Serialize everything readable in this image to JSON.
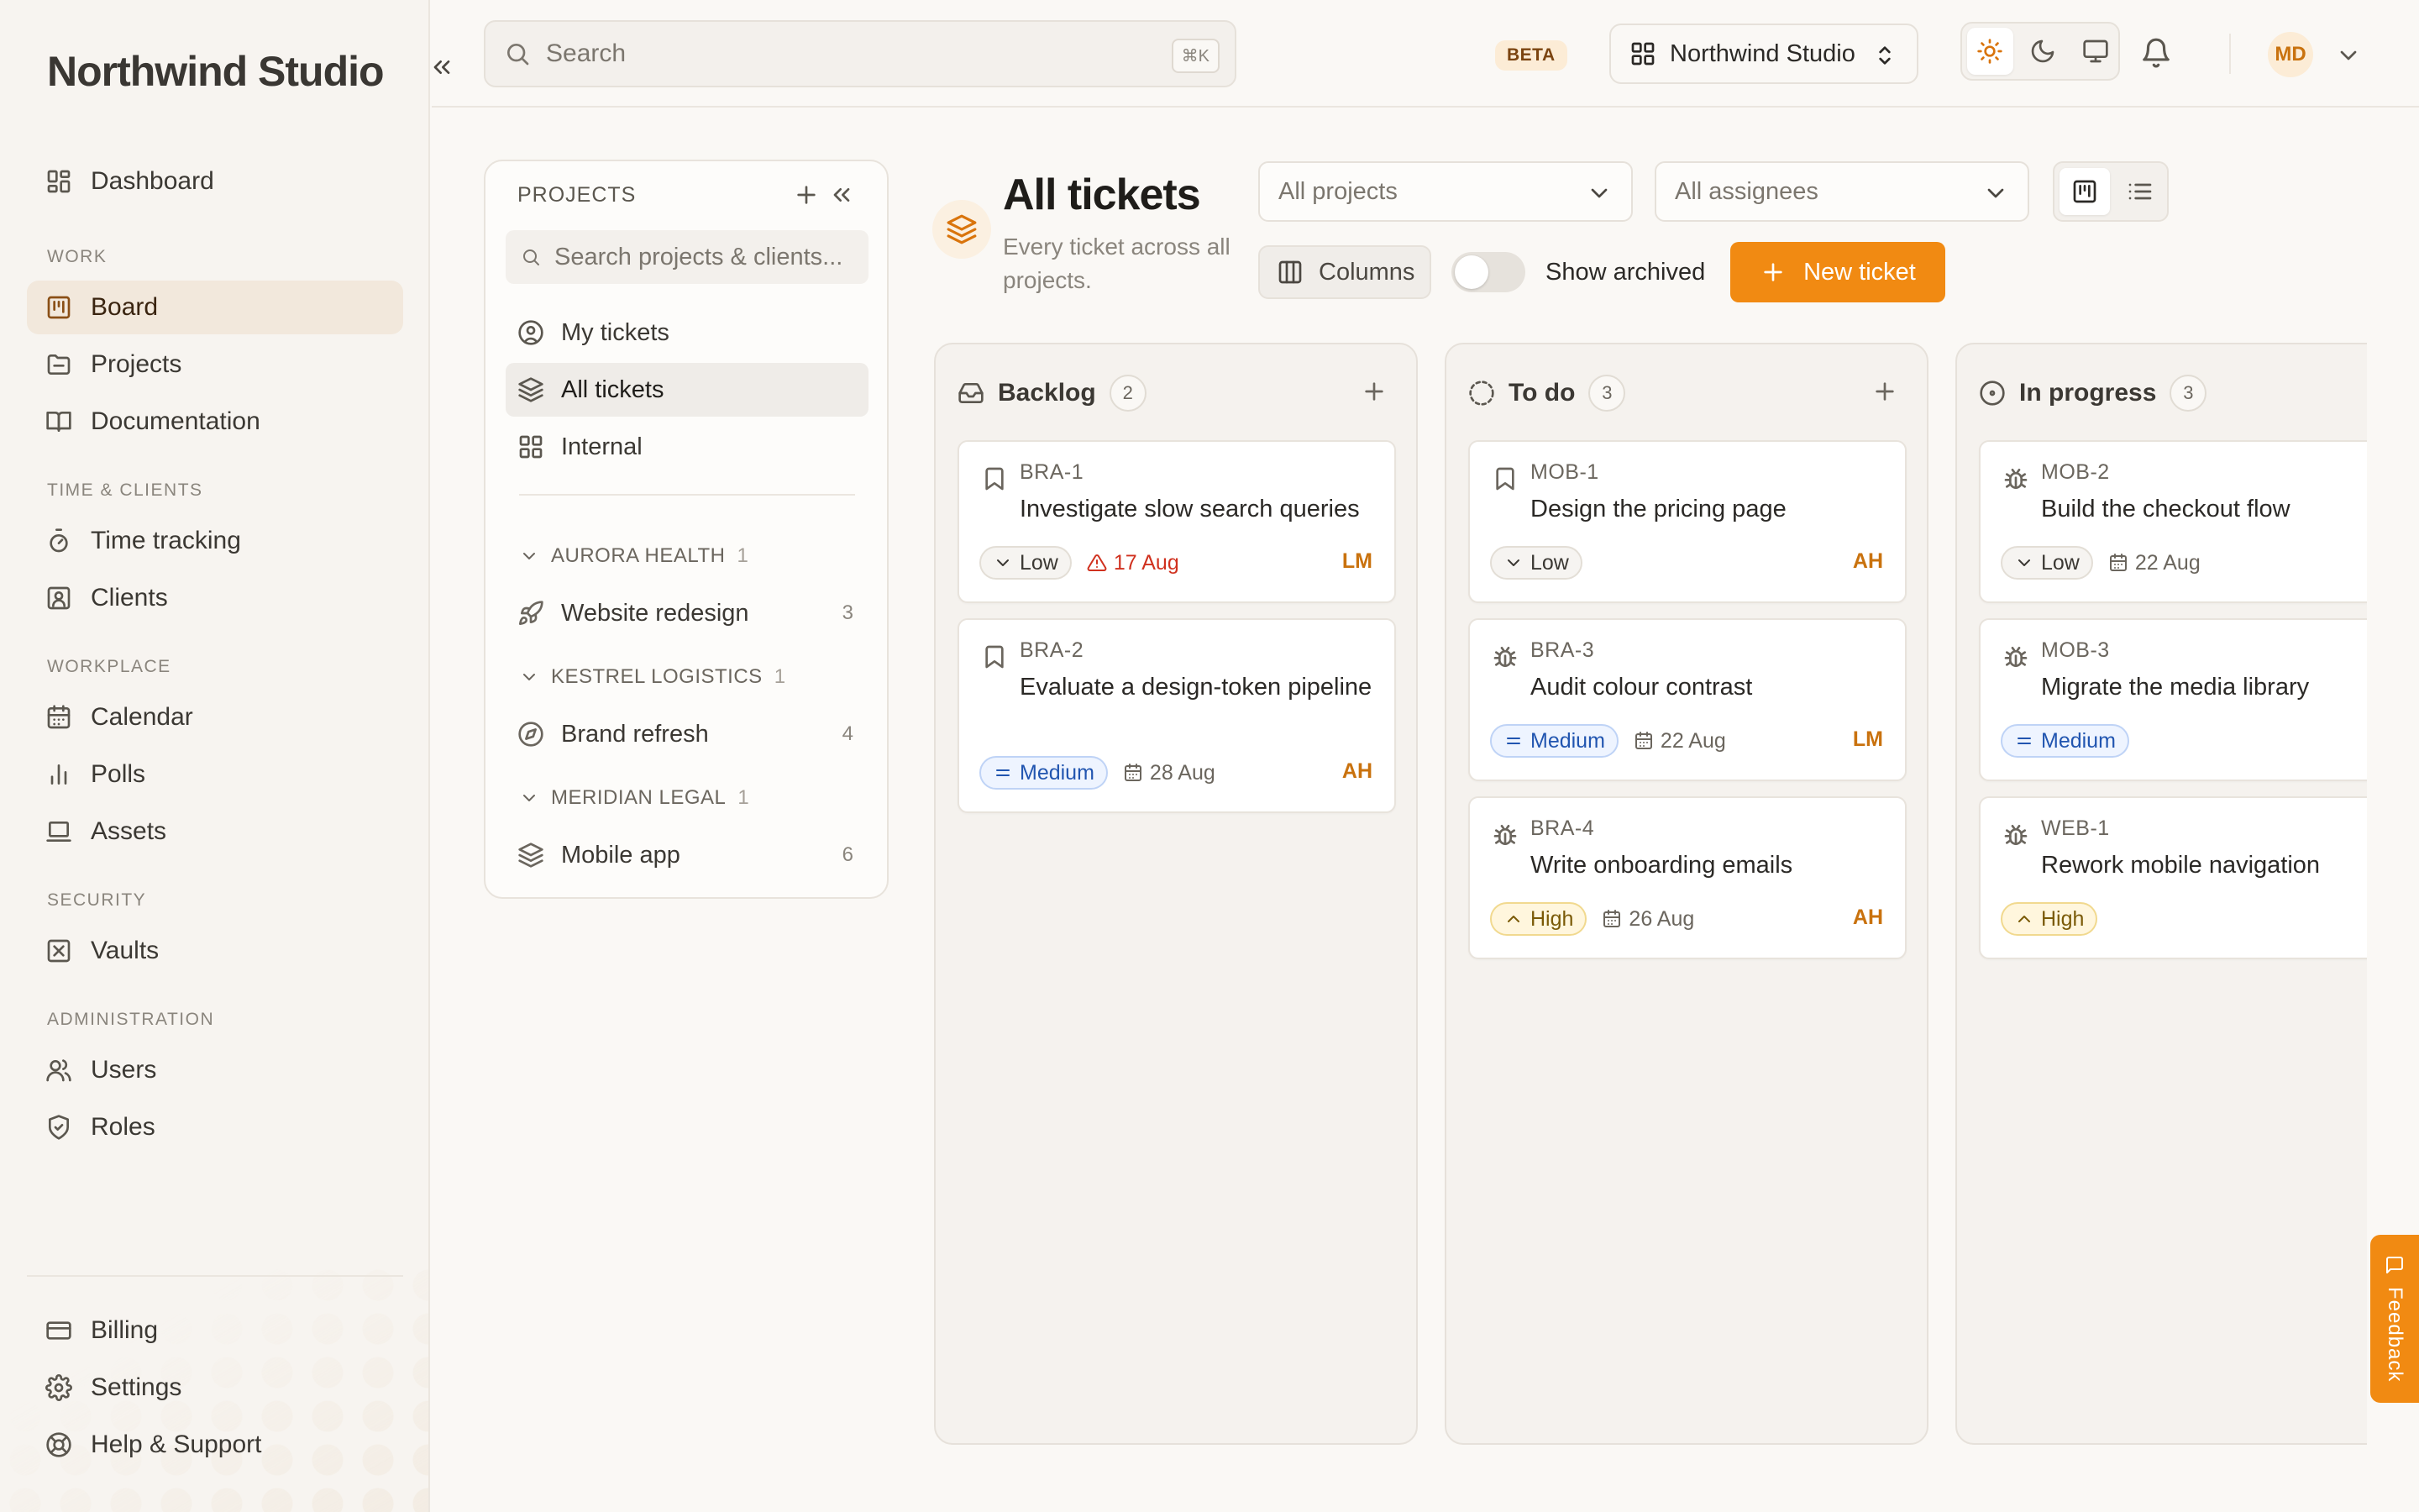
{
  "app": {
    "brand": "Northwind Studio"
  },
  "sidebar": {
    "dashboard": "Dashboard",
    "groups": {
      "work": "WORK",
      "time_clients": "TIME & CLIENTS",
      "workplace": "WORKPLACE",
      "security": "SECURITY",
      "administration": "ADMINISTRATION"
    },
    "items": {
      "board": "Board",
      "projects": "Projects",
      "documentation": "Documentation",
      "time_tracking": "Time tracking",
      "clients": "Clients",
      "calendar": "Calendar",
      "polls": "Polls",
      "assets": "Assets",
      "vaults": "Vaults",
      "users": "Users",
      "roles": "Roles",
      "billing": "Billing",
      "settings": "Settings",
      "help": "Help & Support"
    }
  },
  "topbar": {
    "search_placeholder": "Search",
    "shortcut": "⌘K",
    "beta": "BETA",
    "org": "Northwind Studio",
    "avatar": "MD"
  },
  "projects_panel": {
    "title": "PROJECTS",
    "search_placeholder": "Search projects & clients...",
    "views": {
      "my_tickets": "My tickets",
      "all_tickets": "All tickets",
      "internal": "Internal"
    },
    "clients": [
      {
        "name": "AURORA HEALTH",
        "count": "1",
        "project": "Website redesign",
        "tickets": "3"
      },
      {
        "name": "KESTREL LOGISTICS",
        "count": "1",
        "project": "Brand refresh",
        "tickets": "4"
      },
      {
        "name": "MERIDIAN LEGAL",
        "count": "1",
        "project": "Mobile app",
        "tickets": "6"
      }
    ]
  },
  "header": {
    "title": "All tickets",
    "subtitle": "Every ticket across all projects.",
    "filter_projects": "All projects",
    "filter_assignees": "All assignees",
    "columns": "Columns",
    "show_archived": "Show archived",
    "new_ticket": "New ticket"
  },
  "board": {
    "columns": [
      {
        "name": "Backlog",
        "count": "2",
        "cards": [
          {
            "key": "BRA-1",
            "title": "Investigate slow search queries",
            "priority": "Low",
            "due": "17 Aug",
            "assignee": "LM"
          },
          {
            "key": "BRA-2",
            "title": "Evaluate a design-token pipeline",
            "priority": "Medium",
            "due": "28 Aug",
            "assignee": "AH"
          }
        ]
      },
      {
        "name": "To do",
        "count": "3",
        "cards": [
          {
            "key": "MOB-1",
            "title": "Design the pricing page",
            "priority": "Low",
            "assignee": "AH"
          },
          {
            "key": "BRA-3",
            "title": "Audit colour contrast",
            "priority": "Medium",
            "due": "22 Aug",
            "assignee": "LM"
          },
          {
            "key": "BRA-4",
            "title": "Write onboarding emails",
            "priority": "High",
            "due": "26 Aug",
            "assignee": "AH"
          }
        ]
      },
      {
        "name": "In progress",
        "count": "3",
        "cards": [
          {
            "key": "MOB-2",
            "title": "Build the checkout flow",
            "priority": "Low",
            "due": "22 Aug"
          },
          {
            "key": "MOB-3",
            "title": "Migrate the media library",
            "priority": "Medium"
          },
          {
            "key": "WEB-1",
            "title": "Rework mobile navigation",
            "priority": "High"
          }
        ]
      }
    ]
  },
  "feedback": "Feedback",
  "colors": {
    "accent": "#f18a12",
    "overdue": "#d0311f",
    "medium": "#2155b0"
  }
}
